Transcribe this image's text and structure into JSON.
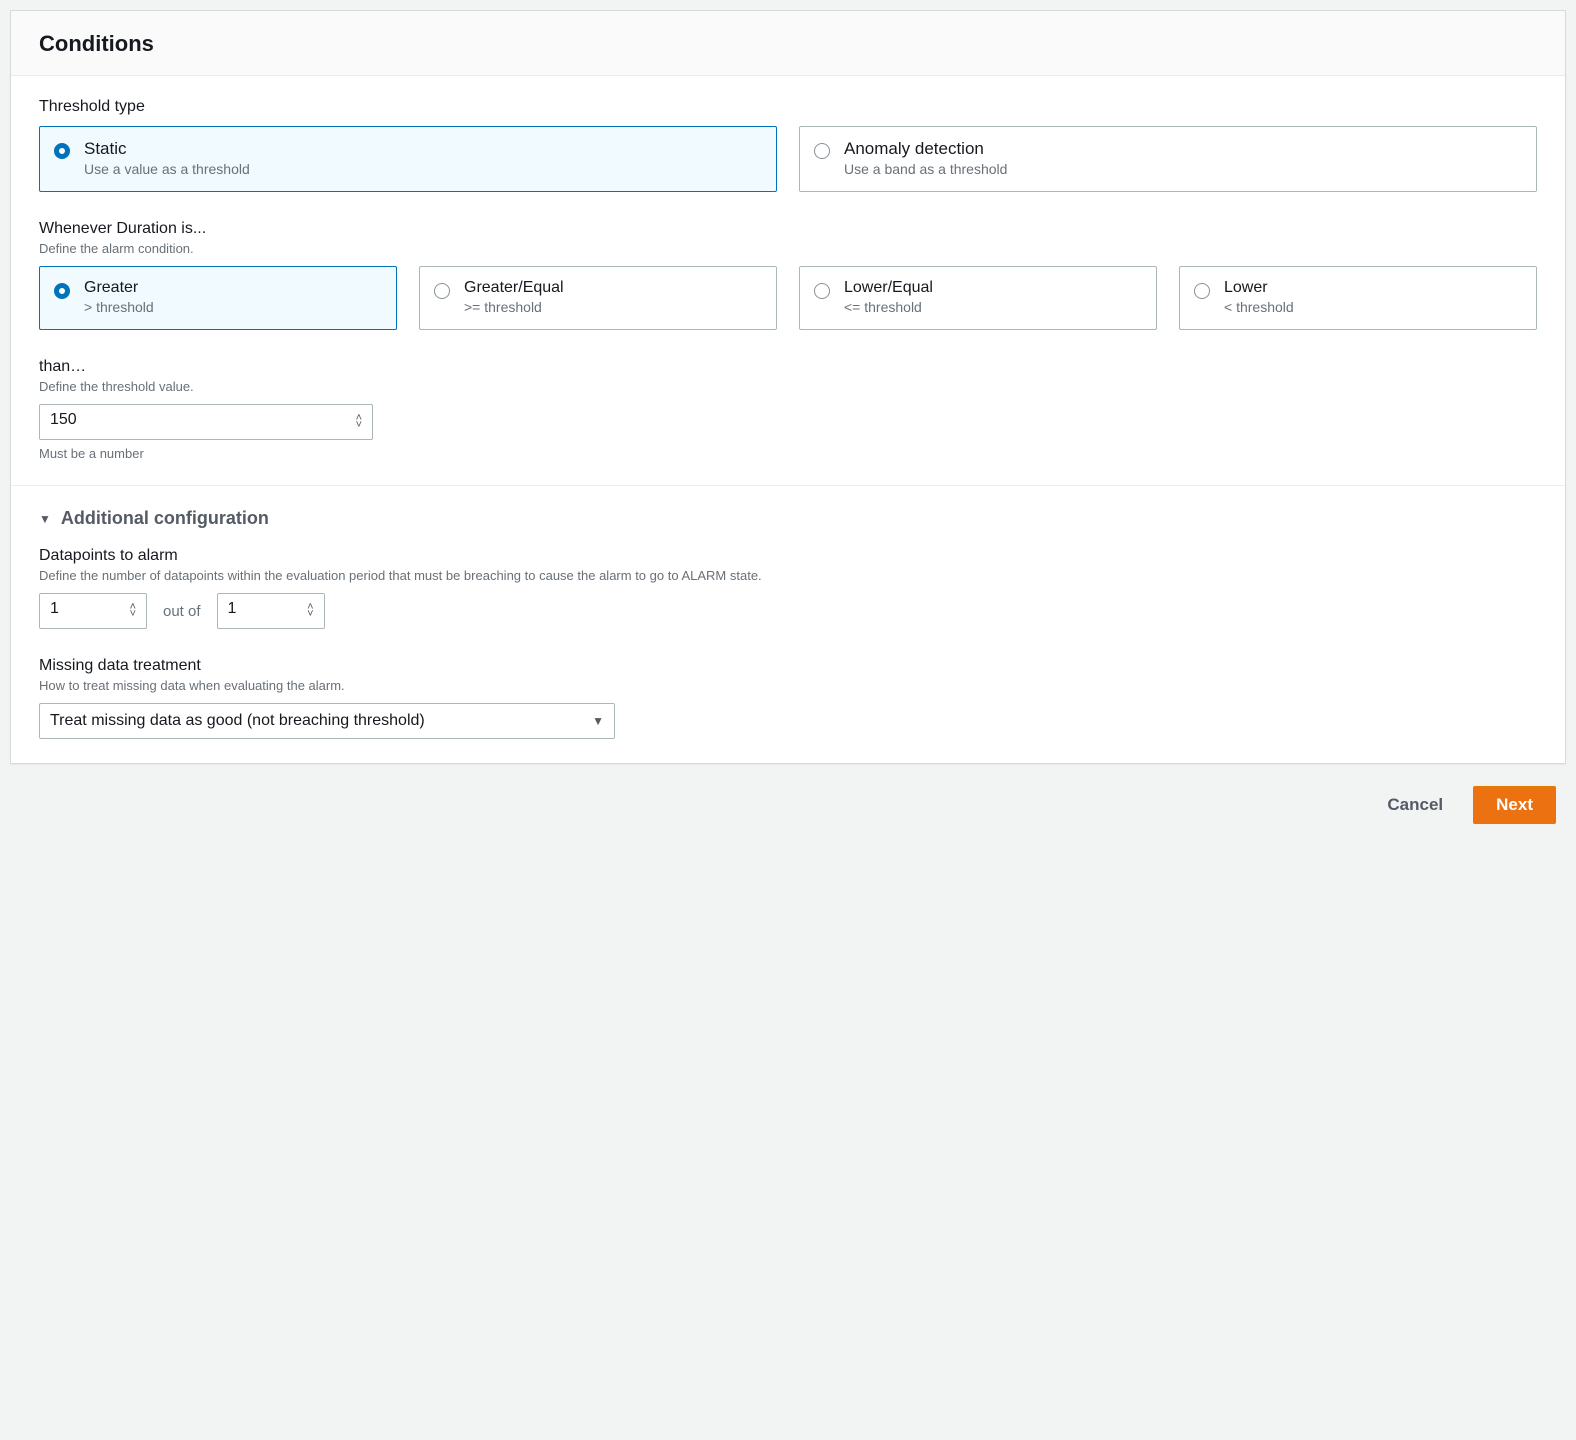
{
  "header": {
    "title": "Conditions"
  },
  "threshold_type": {
    "label": "Threshold type",
    "options": [
      {
        "title": "Static",
        "desc": "Use a value as a threshold",
        "selected": true
      },
      {
        "title": "Anomaly detection",
        "desc": "Use a band as a threshold",
        "selected": false
      }
    ]
  },
  "condition": {
    "label": "Whenever Duration is...",
    "desc": "Define the alarm condition.",
    "options": [
      {
        "title": "Greater",
        "desc": "> threshold",
        "selected": true
      },
      {
        "title": "Greater/Equal",
        "desc": ">= threshold",
        "selected": false
      },
      {
        "title": "Lower/Equal",
        "desc": "<= threshold",
        "selected": false
      },
      {
        "title": "Lower",
        "desc": "< threshold",
        "selected": false
      }
    ]
  },
  "threshold_value": {
    "label": "than…",
    "desc": "Define the threshold value.",
    "value": "150",
    "hint": "Must be a number"
  },
  "additional": {
    "title": "Additional configuration",
    "datapoints": {
      "label": "Datapoints to alarm",
      "desc": "Define the number of datapoints within the evaluation period that must be breaching to cause the alarm to go to ALARM state.",
      "left": "1",
      "mid": "out of",
      "right": "1"
    },
    "missing": {
      "label": "Missing data treatment",
      "desc": "How to treat missing data when evaluating the alarm.",
      "value": "Treat missing data as good (not breaching threshold)"
    }
  },
  "footer": {
    "cancel": "Cancel",
    "next": "Next"
  }
}
